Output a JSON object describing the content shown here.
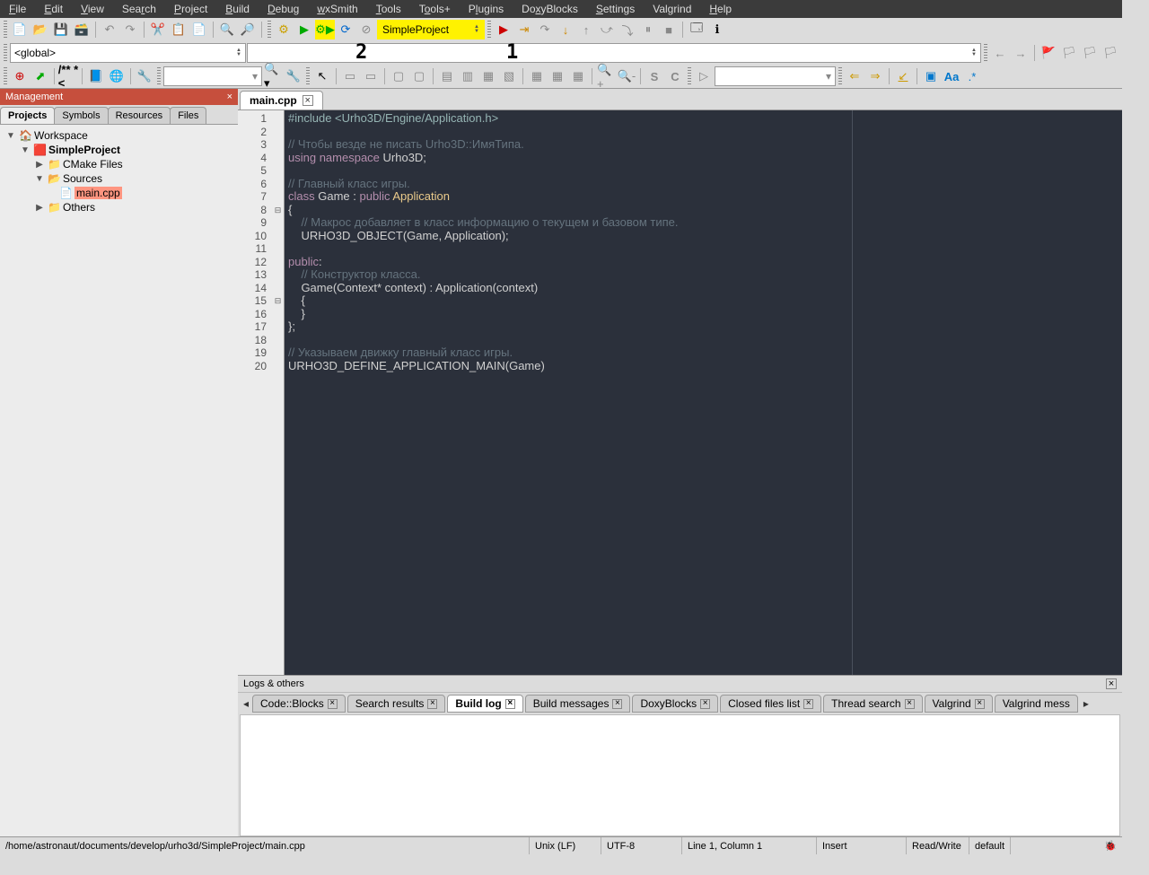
{
  "menu": [
    "File",
    "Edit",
    "View",
    "Search",
    "Project",
    "Build",
    "Debug",
    "wxSmith",
    "Tools",
    "Tools+",
    "Plugins",
    "DoxyBlocks",
    "Settings",
    "Valgrind",
    "Help"
  ],
  "buildTarget": "SimpleProject",
  "scope": "<global>",
  "annotations": {
    "a1": "1",
    "a2": "2"
  },
  "management": {
    "title": "Management",
    "tabs": [
      "Projects",
      "Symbols",
      "Resources",
      "Files"
    ],
    "active": "Projects",
    "workspace": "Workspace",
    "project": "SimpleProject",
    "folders": {
      "cmake": "CMake Files",
      "sources": "Sources",
      "others": "Others"
    },
    "file": "main.cpp"
  },
  "editor": {
    "tab": "main.cpp",
    "lineNumbers": [
      1,
      2,
      3,
      4,
      5,
      6,
      7,
      8,
      9,
      10,
      11,
      12,
      13,
      14,
      15,
      16,
      17,
      18,
      19,
      20
    ],
    "code": {
      "l1": "#include <Urho3D/Engine/Application.h>",
      "l2": "",
      "l3": "// Чтобы везде не писать Urho3D::ИмяТипа.",
      "l4a": "using namespace ",
      "l4b": "Urho3D;",
      "l5": "",
      "l6": "// Главный класс игры.",
      "l7a": "class ",
      "l7b": "Game : ",
      "l7c": "public ",
      "l7d": "Application",
      "l8": "{",
      "l9": "    // Макрос добавляет в класс информацию о текущем и базовом типе.",
      "l10": "    URHO3D_OBJECT(Game, Application);",
      "l11": "",
      "l12a": "public",
      "l12b": ":",
      "l13": "    // Конструктор класса.",
      "l14": "    Game(Context* context) : Application(context)",
      "l15": "    {",
      "l16": "    }",
      "l17": "};",
      "l18": "",
      "l19": "// Указываем движку главный класс игры.",
      "l20": "URHO3D_DEFINE_APPLICATION_MAIN(Game)"
    }
  },
  "logs": {
    "title": "Logs & others",
    "tabs": [
      "Code::Blocks",
      "Search results",
      "Build log",
      "Build messages",
      "DoxyBlocks",
      "Closed files list",
      "Thread search",
      "Valgrind",
      "Valgrind mess"
    ],
    "active": "Build log"
  },
  "status": {
    "path": "/home/astronaut/documents/develop/urho3d/SimpleProject/main.cpp",
    "eol": "Unix (LF)",
    "enc": "UTF-8",
    "pos": "Line 1, Column 1",
    "mode": "Insert",
    "rw": "Read/Write",
    "conf": "default"
  }
}
